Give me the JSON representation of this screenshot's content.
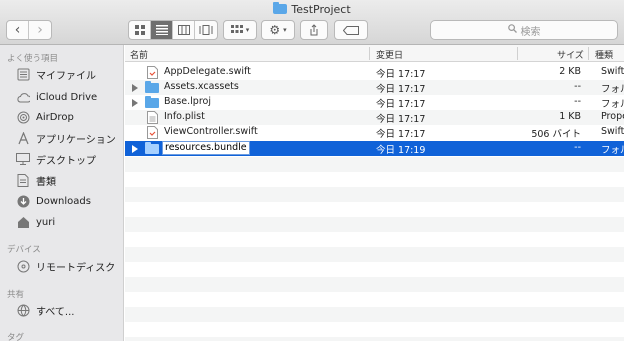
{
  "window": {
    "title": "TestProject"
  },
  "toolbar": {
    "back_label": "‹",
    "forward_label": "›",
    "search_placeholder": "検索",
    "view_modes": [
      "icon",
      "list",
      "column",
      "coverflow"
    ],
    "active_view": "list"
  },
  "sidebar": {
    "sections": [
      {
        "heading": "よく使う項目",
        "items": [
          {
            "label": "マイファイル",
            "icon": "all-files-icon"
          },
          {
            "label": "iCloud Drive",
            "icon": "cloud-icon"
          },
          {
            "label": "AirDrop",
            "icon": "airdrop-icon"
          },
          {
            "label": "アプリケーション",
            "icon": "applications-icon"
          },
          {
            "label": "デスクトップ",
            "icon": "desktop-icon"
          },
          {
            "label": "書類",
            "icon": "documents-icon"
          },
          {
            "label": "Downloads",
            "icon": "downloads-icon"
          },
          {
            "label": "yuri",
            "icon": "home-icon"
          }
        ]
      },
      {
        "heading": "デバイス",
        "items": [
          {
            "label": "リモートディスク",
            "icon": "disc-icon"
          }
        ]
      },
      {
        "heading": "共有",
        "items": [
          {
            "label": "すべて...",
            "icon": "network-icon"
          }
        ]
      },
      {
        "heading": "タグ",
        "items": []
      }
    ]
  },
  "columns": {
    "name": "名前",
    "modified": "変更日",
    "size": "サイズ",
    "kind": "種類"
  },
  "files": [
    {
      "name": "AppDelegate.swift",
      "modified": "今日 17:17",
      "size": "2 KB",
      "kind": "Swift",
      "type": "file",
      "expandable": false
    },
    {
      "name": "Assets.xcassets",
      "modified": "今日 17:17",
      "size": "--",
      "kind": "フォル",
      "type": "folder",
      "expandable": true
    },
    {
      "name": "Base.lproj",
      "modified": "今日 17:17",
      "size": "--",
      "kind": "フォル",
      "type": "folder",
      "expandable": true
    },
    {
      "name": "Info.plist",
      "modified": "今日 17:17",
      "size": "1 KB",
      "kind": "Prope",
      "type": "file",
      "expandable": false
    },
    {
      "name": "ViewController.swift",
      "modified": "今日 17:17",
      "size": "506 バイト",
      "kind": "Swift",
      "type": "file",
      "expandable": false
    },
    {
      "name": "resources.bundle",
      "modified": "今日 17:19",
      "size": "--",
      "kind": "フォル",
      "type": "folder",
      "expandable": true,
      "selected": true,
      "editing": true
    }
  ],
  "colors": {
    "accent": "#1062d8",
    "folder": "#5aa7e8",
    "sidebar_bg": "#e8e8ea"
  }
}
